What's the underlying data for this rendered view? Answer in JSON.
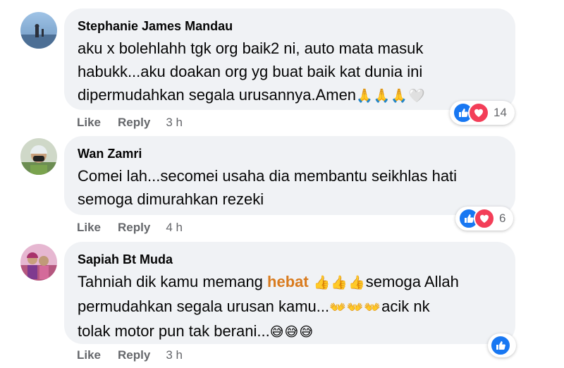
{
  "comments": [
    {
      "author": "Stephanie James Mandau",
      "text_lines": [
        "aku x bolehlahh tgk org baik2 ni, auto mata masuk",
        "habukk...aku doakan org yg buat baik kat dunia ini",
        "dipermudahkan segala urusannya.Amen"
      ],
      "emoji_tail": "🙏🙏🙏🤍",
      "reaction_count": "14",
      "actions": {
        "like": "Like",
        "reply": "Reply",
        "time": "3 h"
      }
    },
    {
      "author": "Wan Zamri",
      "text_lines": [
        "Comei lah...secomei usaha dia membantu seikhlas hati",
        "semoga dimurahkan rezeki"
      ],
      "reaction_count": "6",
      "actions": {
        "like": "Like",
        "reply": "Reply",
        "time": "4 h"
      }
    },
    {
      "author": "Sapiah Bt Muda",
      "line1_pre": "Tahniah dik kamu memang ",
      "line1_bold": "hebat",
      "line1_emoji": " 👍👍👍",
      "line1_post": "semoga Allah",
      "line2_pre": "permudahkan segala urusan kamu...",
      "line2_emoji": "👐👐👐",
      "line2_post": "acik nk",
      "line3_pre": "tolak motor pun tak berani...",
      "line3_emoji": "😅😅😅",
      "actions": {
        "like": "Like",
        "reply": "Reply",
        "time": "3 h"
      }
    }
  ],
  "colors": {
    "bubble": "#f0f2f5",
    "like": "#1877f2",
    "love": "#f33e58",
    "muted": "#65676b",
    "highlight": "#d97b1e"
  },
  "icons": {
    "like": "thumbs-up-icon",
    "love": "heart-icon"
  }
}
